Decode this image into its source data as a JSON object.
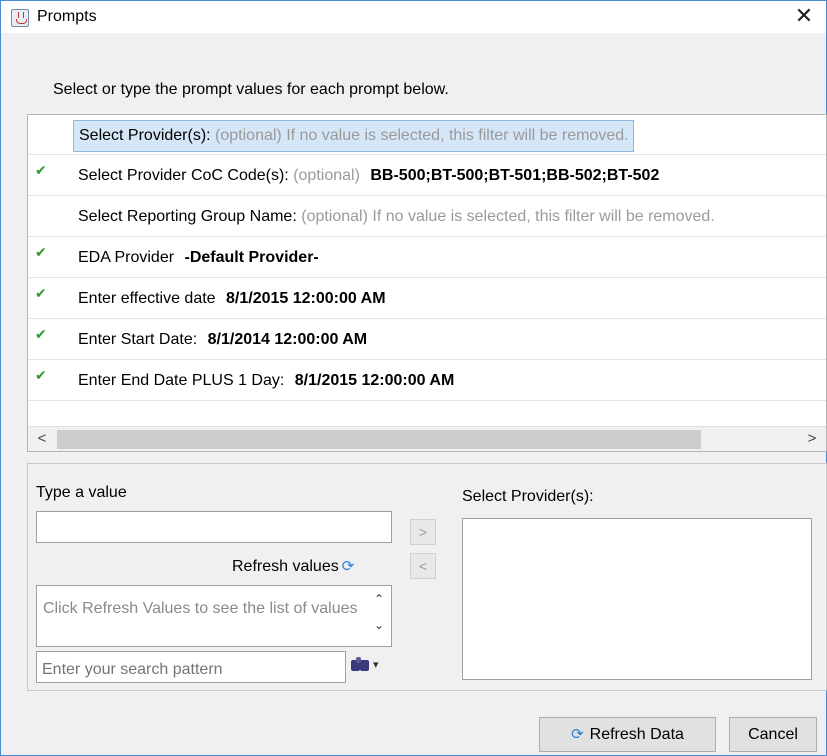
{
  "window": {
    "title": "Prompts",
    "close_glyph": "✕"
  },
  "instruction": "Select or type the prompt values for each prompt below.",
  "prompts": [
    {
      "label": "Select Provider(s):",
      "optional": "(optional) If no value is selected, this filter will be removed.",
      "value": "",
      "checked": false,
      "selected": true
    },
    {
      "label": "Select Provider CoC Code(s):",
      "optional": "(optional)",
      "value": "BB-500;BT-500;BT-501;BB-502;BT-502",
      "checked": true,
      "selected": false
    },
    {
      "label": "Select Reporting Group Name:",
      "optional": "(optional) If no value is selected, this filter will be removed.",
      "value": "",
      "checked": false,
      "selected": false
    },
    {
      "label": "EDA Provider",
      "optional": "",
      "value": "-Default Provider-",
      "checked": true,
      "selected": false
    },
    {
      "label": "Enter effective date",
      "optional": "",
      "value": "8/1/2015 12:00:00 AM",
      "checked": true,
      "selected": false
    },
    {
      "label": "Enter Start Date:",
      "optional": "",
      "value": "8/1/2014 12:00:00 AM",
      "checked": true,
      "selected": false
    },
    {
      "label": "Enter End Date PLUS 1 Day:",
      "optional": "",
      "value": "8/1/2015 12:00:00 AM",
      "checked": true,
      "selected": false
    }
  ],
  "hscroll": {
    "left_glyph": "<",
    "right_glyph": ">"
  },
  "panel": {
    "type_label": "Type a value",
    "refresh_values": "Refresh values",
    "values_hint": "Click Refresh Values to see the list of values",
    "search_placeholder": "Enter your search pattern",
    "selected_label": "Select Provider(s):",
    "add_glyph": ">",
    "remove_glyph": "<"
  },
  "footer": {
    "refresh_data": "Refresh Data",
    "cancel": "Cancel"
  },
  "icons": {
    "check": "✔",
    "refresh": "⟳",
    "scroll_up": "⌃",
    "scroll_down": "⌄",
    "dropdown": "▾"
  },
  "colors": {
    "accent": "#2d7fd6",
    "check": "#2d9a2d",
    "selection": "#d5e6f7"
  }
}
